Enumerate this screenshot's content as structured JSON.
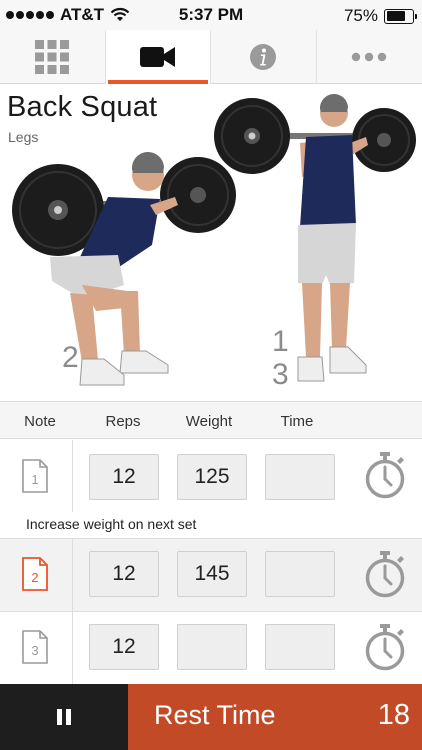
{
  "status_bar": {
    "carrier": "AT&T",
    "time": "5:37 PM",
    "battery": "75%",
    "battery_level": 0.75
  },
  "tabs": [
    {
      "name": "grid",
      "icon": "grid-icon",
      "active": false
    },
    {
      "name": "video",
      "icon": "video-camera-icon",
      "active": true
    },
    {
      "name": "info",
      "icon": "info-icon",
      "active": false
    },
    {
      "name": "more",
      "icon": "more-icon",
      "active": false
    }
  ],
  "exercise": {
    "title": "Back Squat",
    "category": "Legs",
    "steps": {
      "left": "2",
      "right_top": "1",
      "right_bottom": "3"
    }
  },
  "log": {
    "headers": {
      "note": "Note",
      "reps": "Reps",
      "weight": "Weight",
      "time": "Time"
    },
    "sets": [
      {
        "set": "1",
        "reps": "12",
        "weight": "125",
        "time": "",
        "note": "Increase weight on next set",
        "highlighted": false
      },
      {
        "set": "2",
        "reps": "12",
        "weight": "145",
        "time": "",
        "note": "",
        "highlighted": true
      },
      {
        "set": "3",
        "reps": "12",
        "weight": "",
        "time": "",
        "note": "",
        "highlighted": false
      }
    ]
  },
  "rest": {
    "label": "Rest Time",
    "seconds": "18"
  },
  "colors": {
    "accent": "#e8562a",
    "rest_bar": "#c34a26",
    "pause_bg": "#1e1e1e",
    "icon_gray": "#9a9a9a"
  }
}
